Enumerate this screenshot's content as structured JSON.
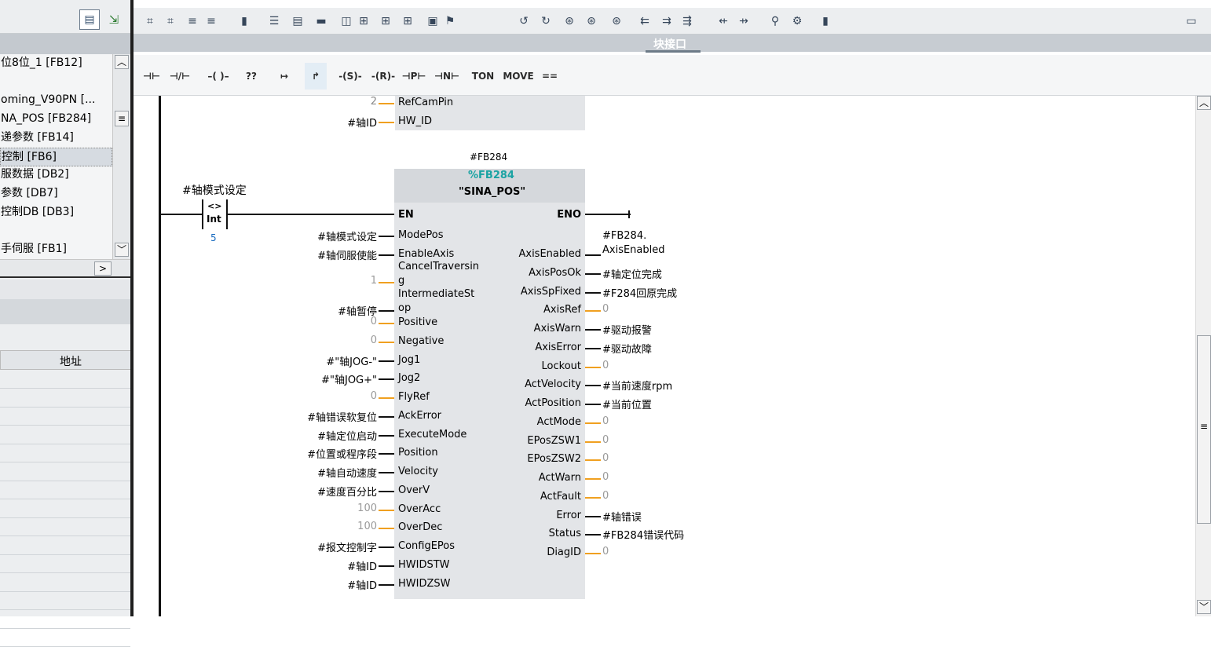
{
  "project_tree": {
    "items": [
      {
        "label": "位8位_1 [FB12]"
      },
      {
        "label": ""
      },
      {
        "label": "oming_V90PN [..."
      },
      {
        "label": "NA_POS [FB284]"
      },
      {
        "label": "递参数 [FB14]"
      },
      {
        "label": "控制 [FB6]"
      },
      {
        "label": "服数据 [DB2]"
      },
      {
        "label": "参数 [DB7]"
      },
      {
        "label": "控制DB [DB3]"
      },
      {
        "label": ""
      },
      {
        "label": "手伺服 [FB1]"
      }
    ]
  },
  "left_table": {
    "address_header": "地址"
  },
  "block_interface": {
    "label": "块接口"
  },
  "lad_toolbar": {
    "items": [
      {
        "name": "no-contact",
        "label": "⊣⊢"
      },
      {
        "name": "nc-contact",
        "label": "⊣/⊢"
      },
      {
        "name": "coil",
        "label": "–( )–"
      },
      {
        "name": "empty-box",
        "label": "??"
      },
      {
        "name": "open-branch",
        "label": "↦"
      },
      {
        "name": "close-branch",
        "label": "↱"
      },
      {
        "name": "set-coil",
        "label": "-(S)-"
      },
      {
        "name": "reset-coil",
        "label": "-(R)-"
      },
      {
        "name": "p-contact",
        "label": "⊣P⊢"
      },
      {
        "name": "n-contact",
        "label": "⊣N⊢"
      },
      {
        "name": "ton",
        "label": "TON"
      },
      {
        "name": "move",
        "label": "MOVE"
      },
      {
        "name": "compare",
        "label": "=="
      }
    ]
  },
  "top_block": {
    "args": [
      {
        "value": "2",
        "pin": "RefCamPin"
      },
      {
        "value": "#轴ID",
        "pin": "HW_ID"
      }
    ]
  },
  "contact": {
    "operand": "#轴模式设定",
    "op": "<>",
    "type": "Int",
    "compare_value": "5"
  },
  "fb": {
    "instance": "#FB284",
    "number": "%FB284",
    "name": "\"SINA_POS\"",
    "en": "EN",
    "eno": "ENO",
    "inputs": [
      {
        "arg": "#轴模式设定",
        "pin": "ModePos",
        "gray": false
      },
      {
        "arg": "#轴伺服使能",
        "pin": "EnableAxis",
        "gray": false
      },
      {
        "arg": "1",
        "pin": "CancelTraversin\ng",
        "gray": true
      },
      {
        "arg": "#轴暂停",
        "pin": "IntermediateSt\nop",
        "gray": false
      },
      {
        "arg": "0",
        "pin": "Positive",
        "gray": true
      },
      {
        "arg": "0",
        "pin": "Negative",
        "gray": true
      },
      {
        "arg": "#\"轴JOG-\"",
        "pin": "Jog1",
        "gray": false
      },
      {
        "arg": "#\"轴JOG+\"",
        "pin": "Jog2",
        "gray": false
      },
      {
        "arg": "0",
        "pin": "FlyRef",
        "gray": true
      },
      {
        "arg": "#轴错误软复位",
        "pin": "AckError",
        "gray": false
      },
      {
        "arg": "#轴定位启动",
        "pin": "ExecuteMode",
        "gray": false
      },
      {
        "arg": "#位置或程序段",
        "pin": "Position",
        "gray": false
      },
      {
        "arg": "#轴自动速度",
        "pin": "Velocity",
        "gray": false
      },
      {
        "arg": "#速度百分比",
        "pin": "OverV",
        "gray": false
      },
      {
        "arg": "100",
        "pin": "OverAcc",
        "gray": true
      },
      {
        "arg": "100",
        "pin": "OverDec",
        "gray": true
      },
      {
        "arg": "#报文控制字",
        "pin": "ConfigEPos",
        "gray": false
      },
      {
        "arg": "#轴ID",
        "pin": "HWIDSTW",
        "gray": false
      },
      {
        "arg": "#轴ID",
        "pin": "HWIDZSW",
        "gray": false
      }
    ],
    "outputs": [
      {
        "pin": "AxisEnabled",
        "arg": "#FB284.\nAxisEnabled",
        "gray": false
      },
      {
        "pin": "AxisPosOk",
        "arg": "#轴定位完成",
        "gray": false
      },
      {
        "pin": "AxisSpFixed",
        "arg": "#F284回原完成",
        "gray": false
      },
      {
        "pin": "AxisRef",
        "arg": "0",
        "gray": true
      },
      {
        "pin": "AxisWarn",
        "arg": "#驱动报警",
        "gray": false
      },
      {
        "pin": "AxisError",
        "arg": "#驱动故障",
        "gray": false
      },
      {
        "pin": "Lockout",
        "arg": "0",
        "gray": true
      },
      {
        "pin": "ActVelocity",
        "arg": "#当前速度rpm",
        "gray": false
      },
      {
        "pin": "ActPosition",
        "arg": "#当前位置",
        "gray": false
      },
      {
        "pin": "ActMode",
        "arg": "0",
        "gray": true
      },
      {
        "pin": "EPosZSW1",
        "arg": "0",
        "gray": true
      },
      {
        "pin": "EPosZSW2",
        "arg": "0",
        "gray": true
      },
      {
        "pin": "ActWarn",
        "arg": "0",
        "gray": true
      },
      {
        "pin": "ActFault",
        "arg": "0",
        "gray": true
      },
      {
        "pin": "Error",
        "arg": "#轴错误",
        "gray": false
      },
      {
        "pin": "Status",
        "arg": "#FB284错误代码",
        "gray": false
      },
      {
        "pin": "DiagID",
        "arg": "0",
        "gray": true
      }
    ]
  },
  "colors": {
    "fb_number": "#1aa3a3",
    "wire_orange": "#f0a020",
    "fb_body": "#e3e5e8"
  }
}
